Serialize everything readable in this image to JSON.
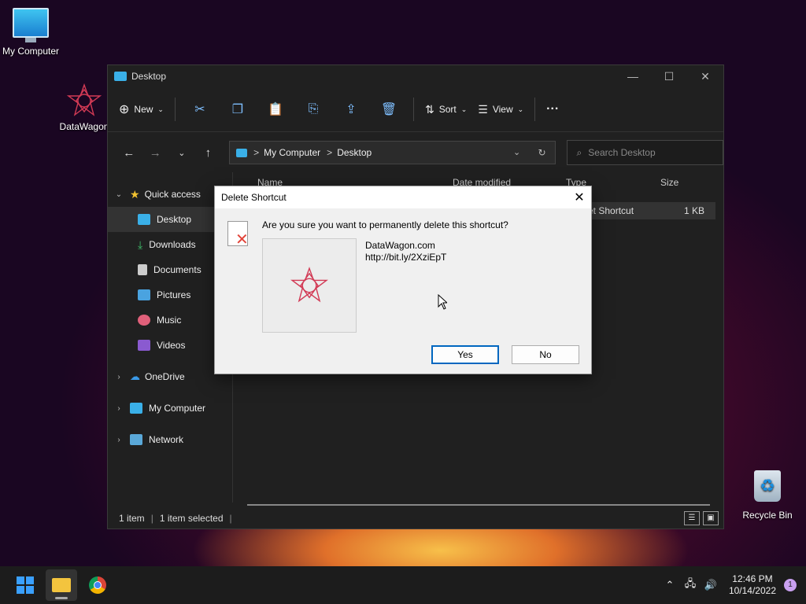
{
  "desktop": {
    "icons": [
      {
        "label": "My Computer"
      },
      {
        "label": "DataWagon"
      },
      {
        "label": "Recycle Bin"
      }
    ]
  },
  "explorer": {
    "title": "Desktop",
    "toolbar": {
      "new_label": "New",
      "sort_label": "Sort",
      "view_label": "View",
      "more_label": "···"
    },
    "address": {
      "crumbs": [
        "My Computer",
        "Desktop"
      ],
      "separator": ">"
    },
    "search_placeholder": "Search Desktop",
    "sidebar": [
      {
        "label": "Quick access"
      },
      {
        "label": "Desktop"
      },
      {
        "label": "Downloads"
      },
      {
        "label": "Documents"
      },
      {
        "label": "Pictures"
      },
      {
        "label": "Music"
      },
      {
        "label": "Videos"
      },
      {
        "label": "OneDrive"
      },
      {
        "label": "My Computer"
      },
      {
        "label": "Network"
      }
    ],
    "columns": [
      "Name",
      "Date modified",
      "Type",
      "Size"
    ],
    "row": {
      "type_fragment": "et Shortcut",
      "size": "1 KB"
    },
    "status": {
      "items": "1 item",
      "selected": "1 item selected"
    }
  },
  "dialog": {
    "title": "Delete Shortcut",
    "question": "Are you sure you want to permanently delete this shortcut?",
    "name": "DataWagon.com",
    "url": "http://bit.ly/2XziEpT",
    "yes_label": "Yes",
    "no_label": "No",
    "close_glyph": "✕"
  },
  "taskbar": {
    "time": "12:46 PM",
    "date": "10/14/2022",
    "notification_count": "1"
  },
  "colors": {
    "accent": "#0067c0",
    "delete_x": "#e2443a",
    "folder": "#f3c43e"
  }
}
